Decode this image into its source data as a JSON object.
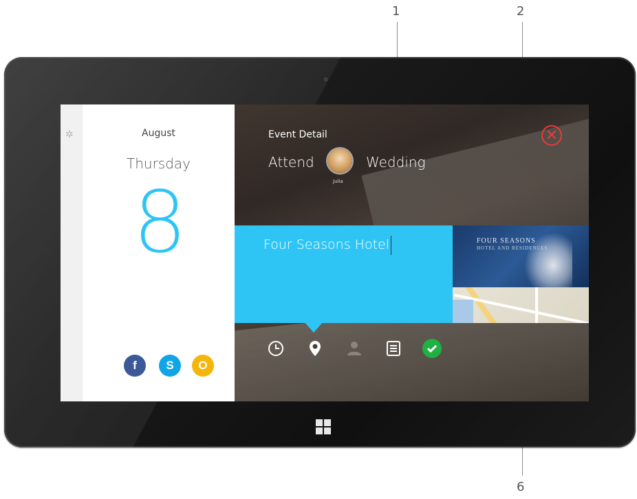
{
  "callouts": {
    "one": "1",
    "two": "2",
    "six": "6"
  },
  "calendar": {
    "month": "August",
    "weekday": "Thursday",
    "day": "8"
  },
  "event": {
    "header": "Event Detail",
    "attend_label": "Attend",
    "person_name": "Julia",
    "event_name": "Wedding",
    "location": "Four Seasons Hotel"
  },
  "hotel_card": {
    "name": "FOUR SEASONS",
    "subtitle": "HOTEL AND RESIDENCES"
  },
  "social": {
    "facebook": "f",
    "skype": "S",
    "outlook": "O"
  },
  "icons": [
    "gear-icon",
    "close-icon",
    "clock-icon",
    "location-pin-icon",
    "person-icon",
    "notes-icon",
    "check-icon",
    "windows-icon",
    "facebook-icon",
    "skype-icon",
    "outlook-icon"
  ],
  "colors": {
    "accent_blue": "#2ec5f5",
    "close_red": "#e63b3b",
    "confirm_green": "#1fb141",
    "facebook": "#3b5998",
    "skype": "#12a5e6",
    "outlook": "#f5b50b"
  }
}
